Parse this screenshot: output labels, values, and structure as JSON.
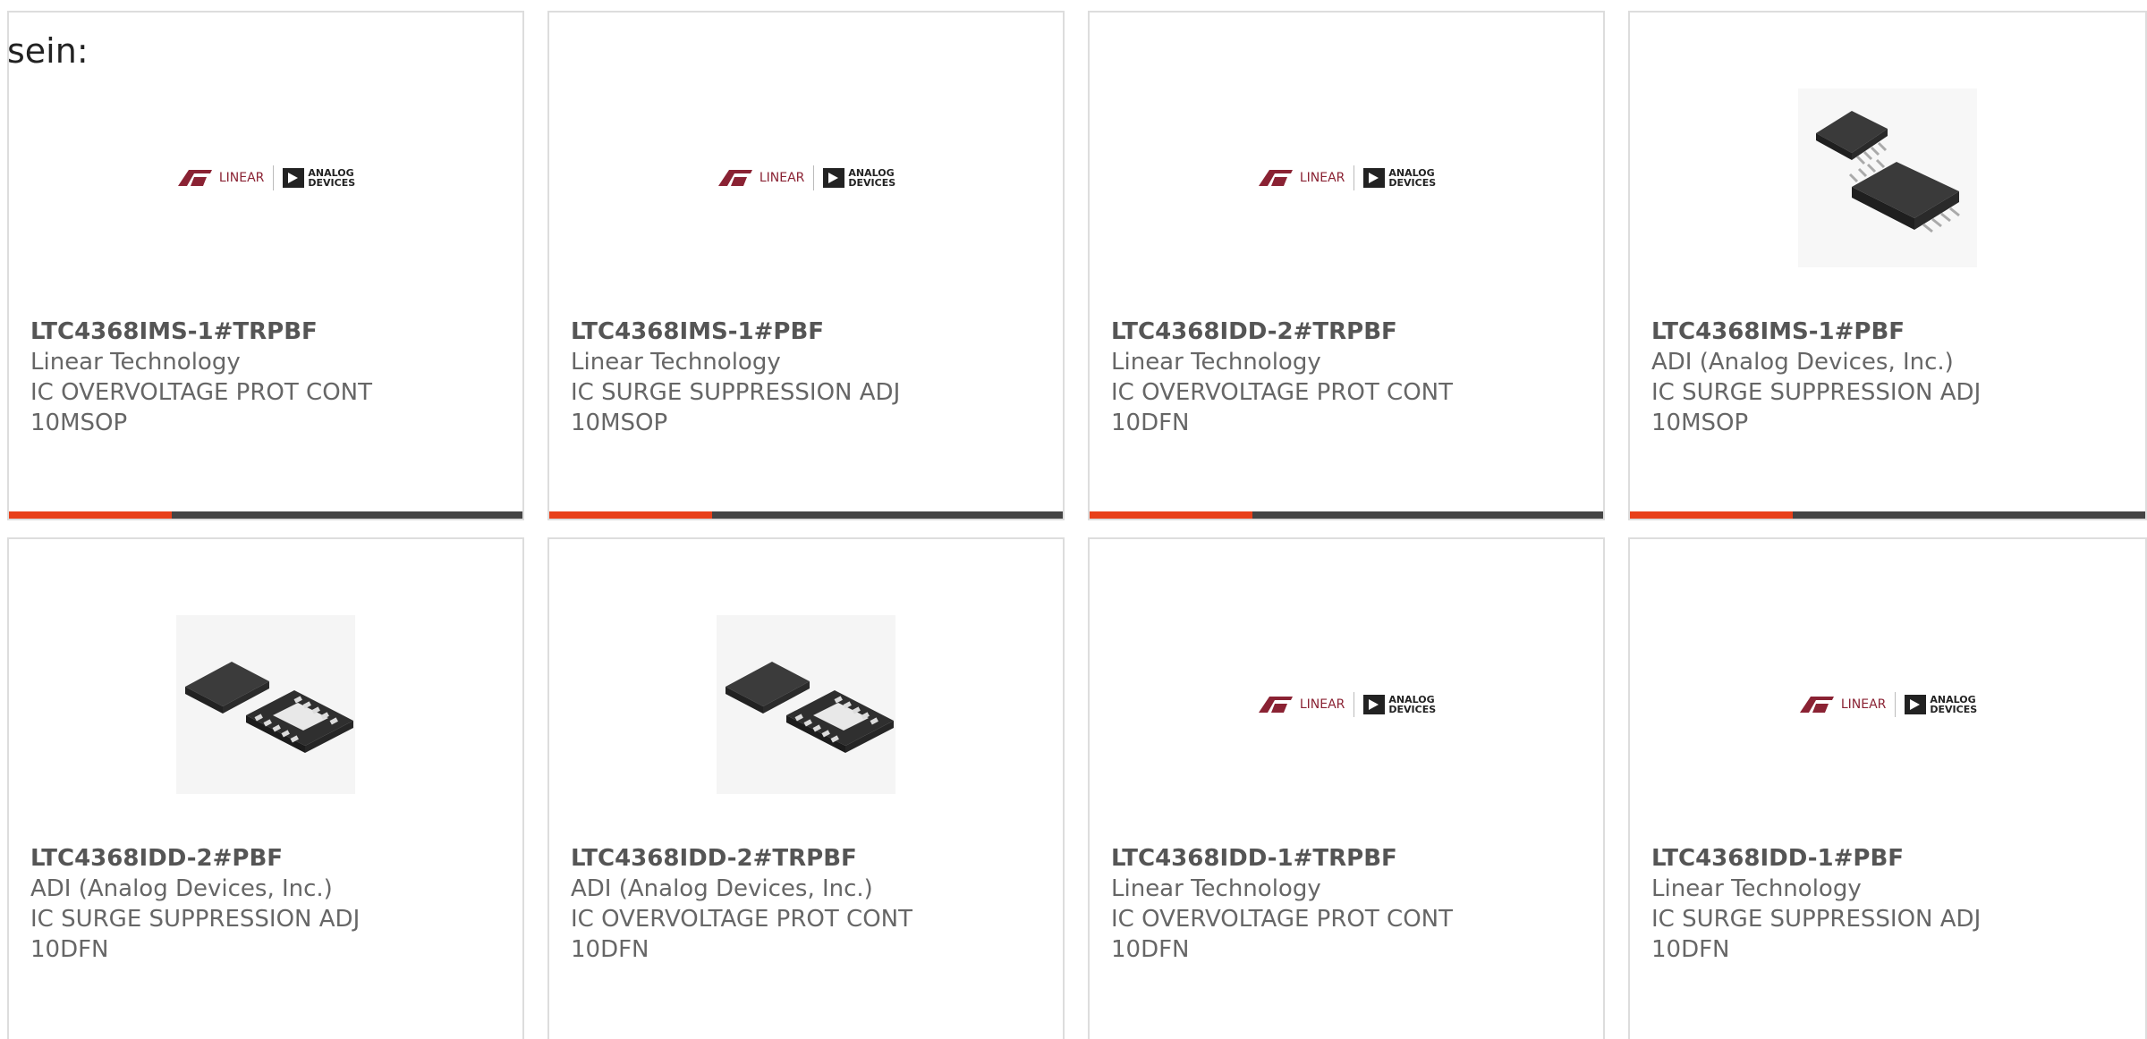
{
  "intro_text": "sein:",
  "colors": {
    "accent": "#e8401a",
    "bar": "#444444",
    "text": "#666666",
    "logo_red": "#8a2233"
  },
  "logo": {
    "linear_text": "LINEAR",
    "adi_line1": "ANALOG",
    "adi_line2": "DEVICES"
  },
  "products": [
    {
      "part": "LTC4368IMS-1#TRPBF",
      "manufacturer": "Linear Technology",
      "description": "IC OVERVOLTAGE PROT CONT",
      "package": "10MSOP",
      "image": "linear-logo"
    },
    {
      "part": "LTC4368IMS-1#PBF",
      "manufacturer": "Linear Technology",
      "description": "IC SURGE SUPPRESSION ADJ",
      "package": "10MSOP",
      "image": "linear-logo"
    },
    {
      "part": "LTC4368IDD-2#TRPBF",
      "manufacturer": "Linear Technology",
      "description": "IC OVERVOLTAGE PROT CONT",
      "package": "10DFN",
      "image": "linear-logo"
    },
    {
      "part": "LTC4368IMS-1#PBF",
      "manufacturer": "ADI (Analog Devices, Inc.)",
      "description": "IC SURGE SUPPRESSION ADJ",
      "package": "10MSOP",
      "image": "msop-chip-photo"
    },
    {
      "part": "LTC4368IDD-2#PBF",
      "manufacturer": "ADI (Analog Devices, Inc.)",
      "description": "IC SURGE SUPPRESSION ADJ",
      "package": "10DFN",
      "image": "dfn-chip-photo"
    },
    {
      "part": "LTC4368IDD-2#TRPBF",
      "manufacturer": "ADI (Analog Devices, Inc.)",
      "description": "IC OVERVOLTAGE PROT CONT",
      "package": "10DFN",
      "image": "dfn-chip-photo"
    },
    {
      "part": "LTC4368IDD-1#TRPBF",
      "manufacturer": "Linear Technology",
      "description": "IC OVERVOLTAGE PROT CONT",
      "package": "10DFN",
      "image": "linear-logo"
    },
    {
      "part": "LTC4368IDD-1#PBF",
      "manufacturer": "Linear Technology",
      "description": "IC SURGE SUPPRESSION ADJ",
      "package": "10DFN",
      "image": "linear-logo"
    }
  ]
}
